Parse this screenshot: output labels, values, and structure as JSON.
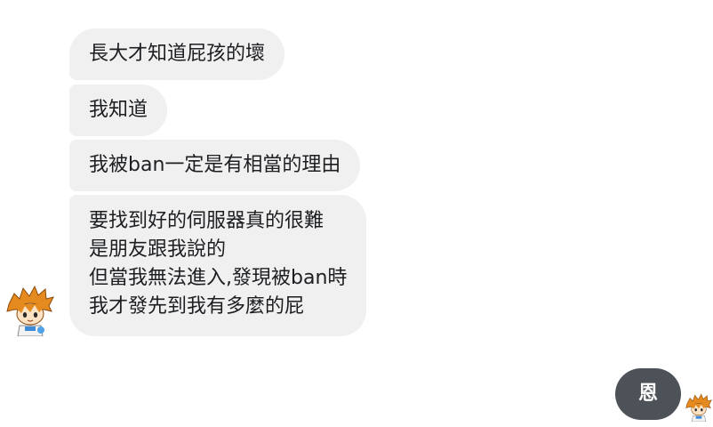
{
  "conversation": {
    "incoming": [
      {
        "lines": [
          "長大才知道屁孩的壞"
        ]
      },
      {
        "lines": [
          "我知道"
        ]
      },
      {
        "lines": [
          "我被ban一定是有相當的理由"
        ]
      },
      {
        "lines": [
          "要找到好的伺服器真的很難",
          "是朋友跟我說的",
          "但當我無法進入,發現被ban時",
          "我才發先到我有多麼的屁"
        ]
      }
    ],
    "outgoing": [
      {
        "text": "恩"
      }
    ]
  },
  "colors": {
    "incoming_bubble": "#f0f0f0",
    "outgoing_bubble": "#4d5258",
    "text": "#1c1e21",
    "page_bg": "#ffffff"
  },
  "icons": {
    "sender_avatar": "cartoon-boy-avatar",
    "seen_avatar": "cartoon-boy-avatar"
  }
}
